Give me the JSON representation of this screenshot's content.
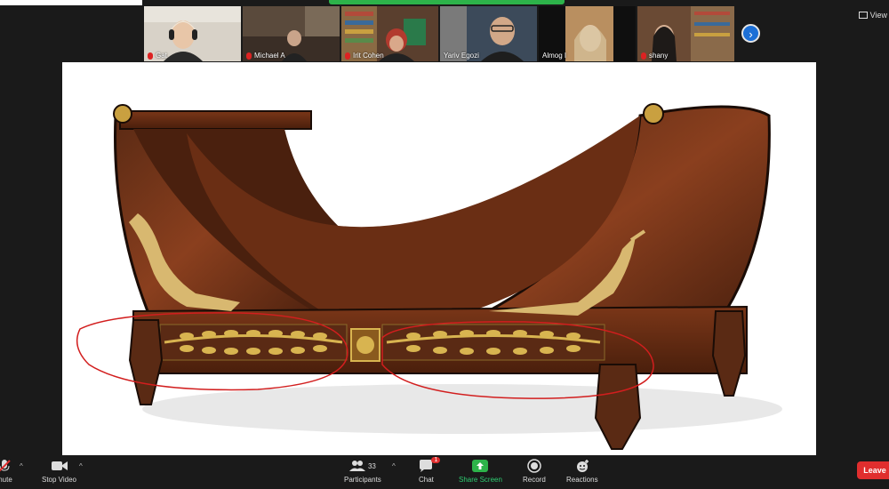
{
  "view_label": "View",
  "participants_gallery": [
    {
      "name": "Gat",
      "muted": true,
      "bg": "#d8d2c8"
    },
    {
      "name": "Michael A",
      "muted": true,
      "bg": "#6b5a4a"
    },
    {
      "name": "Irit Cohen",
      "muted": true,
      "bg": "#6b4f3a"
    },
    {
      "name": "Yariv Egozi",
      "muted": false,
      "bg": "#3c4a5a"
    },
    {
      "name": "Almog I",
      "muted": false,
      "bg": "#b98f60"
    },
    {
      "name": "shany",
      "muted": true,
      "bg": "#7a5a44"
    }
  ],
  "toolbar": {
    "mute_label": "mute",
    "video_label": "Stop Video",
    "participants_label": "Participants",
    "participants_count": "33",
    "chat_label": "Chat",
    "chat_badge": "1",
    "share_label": "Share Screen",
    "record_label": "Record",
    "reactions_label": "Reactions",
    "leave_label": "Leave"
  },
  "colors": {
    "accent_green": "#2db34a",
    "leave_red": "#e02e2e",
    "next_blue": "#1c6fd6"
  }
}
